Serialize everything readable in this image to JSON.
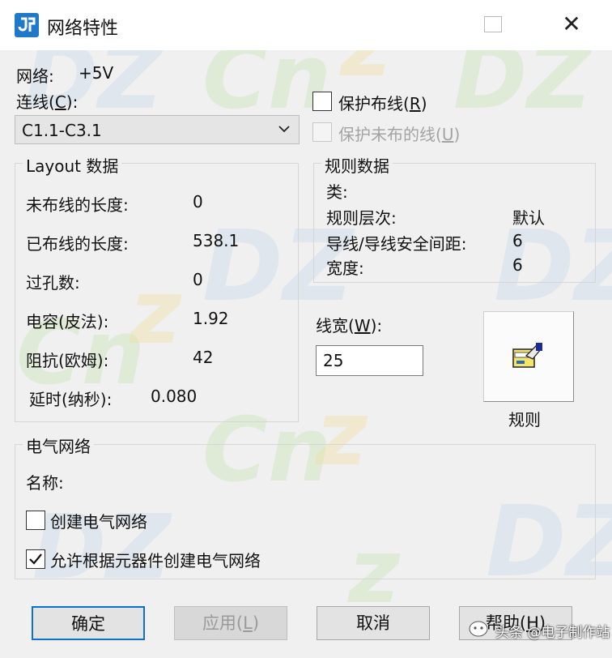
{
  "window": {
    "title": "网络特性"
  },
  "net": {
    "label": "网络:",
    "value": "+5V"
  },
  "connection": {
    "label_main": "连线(",
    "label_key": "C",
    "label_end": "):",
    "selected": "C1.1-C3.1"
  },
  "options": {
    "protect_routing": {
      "label_main": "保护布线(",
      "label_key": "R",
      "label_end": ")",
      "checked": false
    },
    "protect_unrouted": {
      "label_main": "保护未布的线(",
      "label_key": "U",
      "label_end": ")",
      "checked": false,
      "enabled": false
    }
  },
  "layout_data": {
    "title": "Layout 数据",
    "rows": [
      {
        "label": "未布线的长度:",
        "value": "0"
      },
      {
        "label": "已布线的长度:",
        "value": "538.1"
      },
      {
        "label": "过孔数:",
        "value": "0"
      },
      {
        "label": "电容(皮法):",
        "value": "1.92"
      },
      {
        "label": "阻抗(欧姆):",
        "value": "42"
      },
      {
        "label": "延时(纳秒):",
        "value": "0.080"
      }
    ]
  },
  "rule_data": {
    "title": "规则数据",
    "class_label": "类:",
    "class_value": "",
    "rows": [
      {
        "label": "规则层次:",
        "value": "默认"
      },
      {
        "label": "导线/导线安全间距:",
        "value": "6"
      },
      {
        "label": "宽度:",
        "value": "6"
      }
    ]
  },
  "line_width": {
    "label_main": "线宽(",
    "label_key": "W",
    "label_end": "):",
    "value": "25"
  },
  "rules_button": {
    "label": "规则",
    "icon": "rules-icon"
  },
  "electrical_net": {
    "title": "电气网络",
    "name_label": "名称:",
    "create_checkbox": {
      "label": "创建电气网络",
      "checked": false
    },
    "allow_checkbox": {
      "label": "允许根据元器件创建电气网络",
      "checked": true
    }
  },
  "buttons": {
    "ok": "确定",
    "apply_main": "应用(",
    "apply_key": "L",
    "apply_end": ")",
    "cancel": "取消",
    "help_main": "帮助(",
    "help_key": "H",
    "help_end": ")"
  },
  "watermark": {
    "brand": "头条 @电子制作站"
  },
  "colors": {
    "accent": "#0b6fd3",
    "titlebar": "#ffffff",
    "dialog": "#f0f0f0"
  }
}
